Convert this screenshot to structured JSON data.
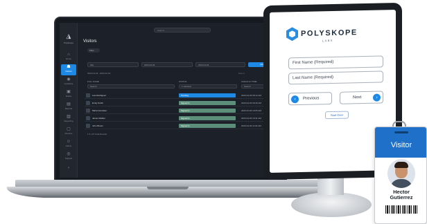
{
  "laptop_app": {
    "search_placeholder": "Search...",
    "sidebar": {
      "logo_label": "Polyskope",
      "items": [
        {
          "label": "Home",
          "icon": "home-icon"
        },
        {
          "label": "Visitors",
          "icon": "visitors-icon",
          "active": true
        },
        {
          "label": "Locations",
          "icon": "location-icon"
        },
        {
          "label": "Notice",
          "icon": "notice-icon"
        },
        {
          "label": "Reports",
          "icon": "reports-icon"
        },
        {
          "label": "Reporting",
          "icon": "chart-icon"
        },
        {
          "label": "Devices",
          "icon": "device-icon"
        },
        {
          "label": "Admin",
          "icon": "admin-icon"
        },
        {
          "label": "Support",
          "icon": "support-icon"
        }
      ]
    },
    "page_title": "Visitors",
    "filter_pill": "Filter",
    "filters": [
      "Site",
      "2023-04-03",
      "2023-04-04"
    ],
    "apply_label": "Apply",
    "date_range": "2023-04-03 - 2023-04-04",
    "range_hint": "Export",
    "columns": [
      "Full Name",
      "Status",
      "Check-In Time"
    ],
    "column_selects": [
      "Search",
      "1 selected",
      "Search"
    ],
    "rows": [
      {
        "name": "Luis Rodriguez",
        "status": "Pending",
        "time": "2023-04-03 09:12 AM",
        "color": "#1e88e5"
      },
      {
        "name": "Emily Smith",
        "status": "Signed In",
        "time": "2023-04-03 09:40 AM",
        "color": "#5c8f7a"
      },
      {
        "name": "Maria Gonzalez",
        "status": "Signed In",
        "time": "2023-04-03 10:05 AM",
        "color": "#5c8f7a"
      },
      {
        "name": "James Walker",
        "status": "Signed In",
        "time": "2023-04-03 10:31 AM",
        "color": "#5c8f7a"
      },
      {
        "name": "John Brown",
        "status": "Signed In",
        "time": "2023-04-03 11:02 AM",
        "color": "#5c8f7a"
      }
    ],
    "pager": "1-5 of 5 Total Results"
  },
  "tablet": {
    "brand": "POLYSKOPE",
    "brand_sub": "LABS",
    "first_name_placeholder": "First Name (Required)",
    "last_name_placeholder": "Last Name (Required)",
    "previous_label": "Previous",
    "next_label": "Next",
    "start_over_label": "Start Over",
    "accent": "#1e88e5"
  },
  "badge": {
    "title": "Visitor",
    "first_name": "Hector",
    "last_name": "Gutierrez",
    "color": "#1e70c8"
  }
}
